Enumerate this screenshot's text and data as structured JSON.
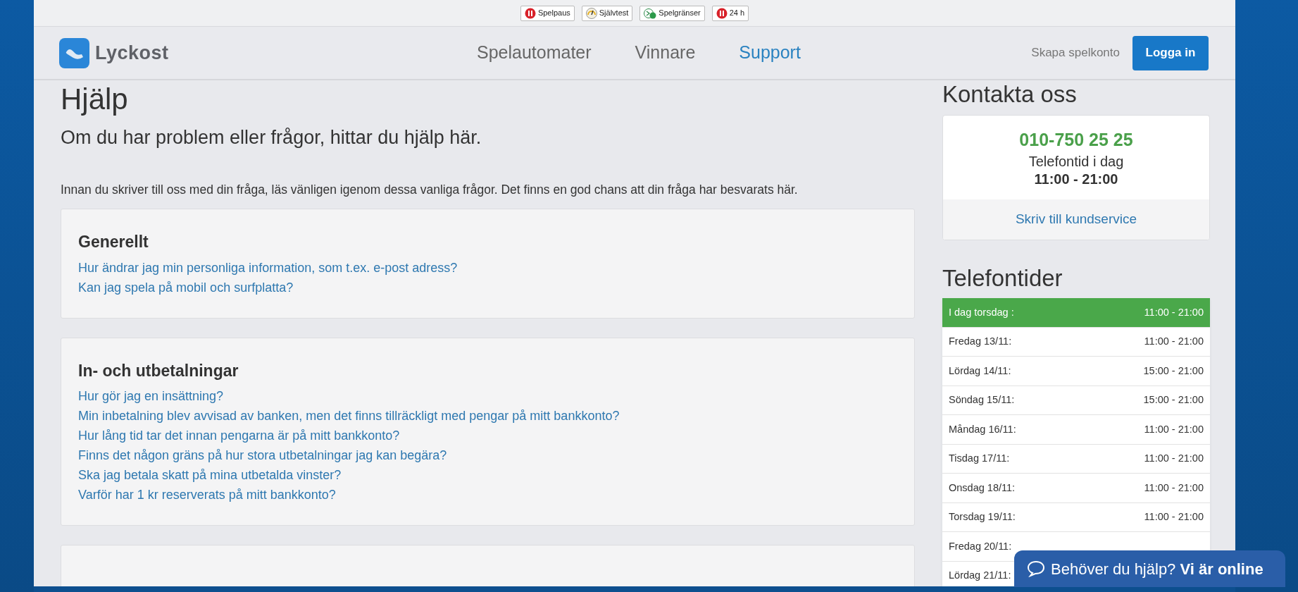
{
  "toolbar": [
    {
      "label": "Spelpaus",
      "kind": "pause"
    },
    {
      "label": "Självtest",
      "kind": "gauge"
    },
    {
      "label": "Spelgränser",
      "kind": "limits"
    },
    {
      "label": "24 h",
      "kind": "pause"
    }
  ],
  "header": {
    "logo": "Lyckost",
    "nav": [
      {
        "label": "Spelautomater",
        "selected": false
      },
      {
        "label": "Vinnare",
        "selected": false
      },
      {
        "label": "Support",
        "selected": true
      }
    ],
    "create_account": "Skapa spelkonto",
    "login": "Logga in"
  },
  "main": {
    "title": "Hjälp",
    "subtitle": "Om du har problem eller frågor, hittar du hjälp här.",
    "intro": "Innan du skriver till oss med din fråga, läs vänligen igenom dessa vanliga frågor. Det finns en god chans att din fråga har besvarats här.",
    "sections": [
      {
        "kind": "faq",
        "heading": "Generellt",
        "links": [
          "Hur ändrar jag min personliga information, som t.ex. e-post adress?",
          "Kan jag spela på mobil och surfplatta?"
        ]
      },
      {
        "kind": "faq",
        "heading": "In- och utbetalningar",
        "links": [
          "Hur gör jag en insättning?",
          "Min inbetalning blev avvisad av banken, men det finns tillräckligt med pengar på mitt bankkonto?",
          "Hur lång tid tar det innan pengarna är på mitt bankkonto?",
          "Finns det någon gräns på hur stora utbetalningar jag kan begära?",
          "Ska jag betala skatt på mina utbetalda vinster?",
          "Varför har 1 kr reserverats på mitt bankkonto?"
        ]
      },
      {
        "kind": "faq"
      }
    ]
  },
  "contact": {
    "title": "Kontakta oss",
    "phone": "010-750 25 25",
    "hours_label": "Telefontid i dag",
    "hours": "11:00 - 21:00",
    "write_link": "Skriv till kundservice"
  },
  "phone_hours": {
    "title": "Telefontider",
    "rows": [
      {
        "day": "I dag torsdag :",
        "hours": "11:00 - 21:00",
        "selected": true
      },
      {
        "day": "Fredag 13/11:",
        "hours": "11:00 - 21:00",
        "selected": false
      },
      {
        "day": "Lördag 14/11:",
        "hours": "15:00 - 21:00",
        "selected": false
      },
      {
        "day": "Söndag 15/11:",
        "hours": "15:00 - 21:00",
        "selected": false
      },
      {
        "day": "Måndag 16/11:",
        "hours": "11:00 - 21:00",
        "selected": false
      },
      {
        "day": "Tisdag 17/11:",
        "hours": "11:00 - 21:00",
        "selected": false
      },
      {
        "day": "Onsdag 18/11:",
        "hours": "11:00 - 21:00",
        "selected": false
      },
      {
        "day": "Torsdag 19/11:",
        "hours": "11:00 - 21:00",
        "selected": false
      },
      {
        "day": "Fredag 20/11:",
        "selected": false
      },
      {
        "day": "Lördag 21/11:",
        "selected": false
      }
    ]
  },
  "chat": {
    "label": "Behöver du hjälp? **Vi är online**"
  }
}
